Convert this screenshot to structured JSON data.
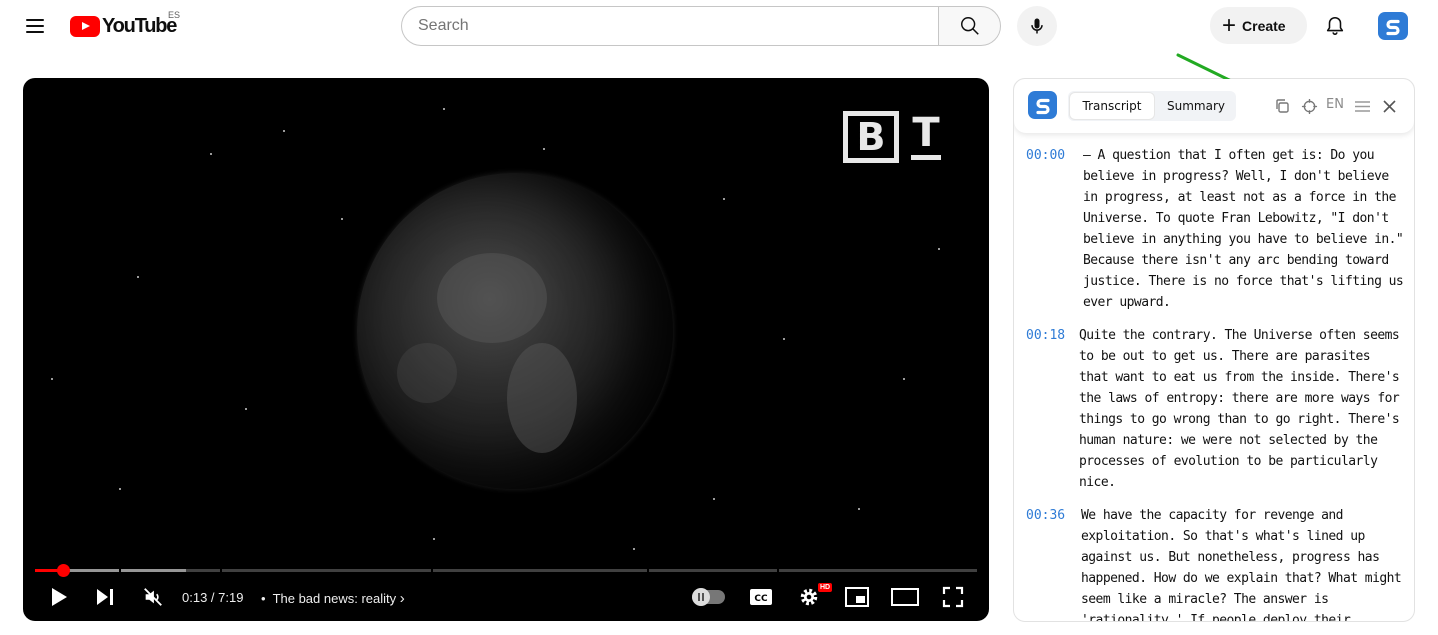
{
  "header": {
    "logo_text": "YouTube",
    "region": "ES",
    "search_placeholder": "Search",
    "create_label": "Create"
  },
  "player": {
    "time": "0:13 / 7:19",
    "separator": "•",
    "chapter": "The bad news: reality",
    "progress_fraction": 0.03,
    "buffered_fraction": 0.16,
    "hd_badge": "HD",
    "watermark_b": "B",
    "watermark_t": "T"
  },
  "panel": {
    "tabs": [
      {
        "label": "Transcript",
        "active": true
      },
      {
        "label": "Summary",
        "active": false
      }
    ],
    "language": "EN",
    "entries": [
      {
        "time": "00:00",
        "text": "– A question that I often get is: Do you believe in progress? Well, I don't believe in progress, at least not as a force in the Universe. To quote Fran Lebowitz, \"I don't believe in anything you have to believe in.\" Because there isn't any arc bending toward justice. There is no force that's lifting us ever upward."
      },
      {
        "time": "00:18",
        "text": "Quite the contrary. The Universe often seems to be out to get us. There are parasites that want to eat us from the inside. There's the laws of entropy: there are more ways for things to go wrong than to go right. There's human nature: we were not selected by the processes of evolution to be particularly nice."
      },
      {
        "time": "00:36",
        "text": "We have the capacity for revenge and exploitation. So that's what's lined up against us. But nonetheless, progress has happened. How do we explain that? What might seem like a miracle? The answer is 'rationality.' If people deploy their"
      }
    ]
  },
  "colors": {
    "youtube_red": "#ff0000",
    "extension_blue": "#2e7bd6",
    "annotation_arrow": "#22aa22"
  }
}
